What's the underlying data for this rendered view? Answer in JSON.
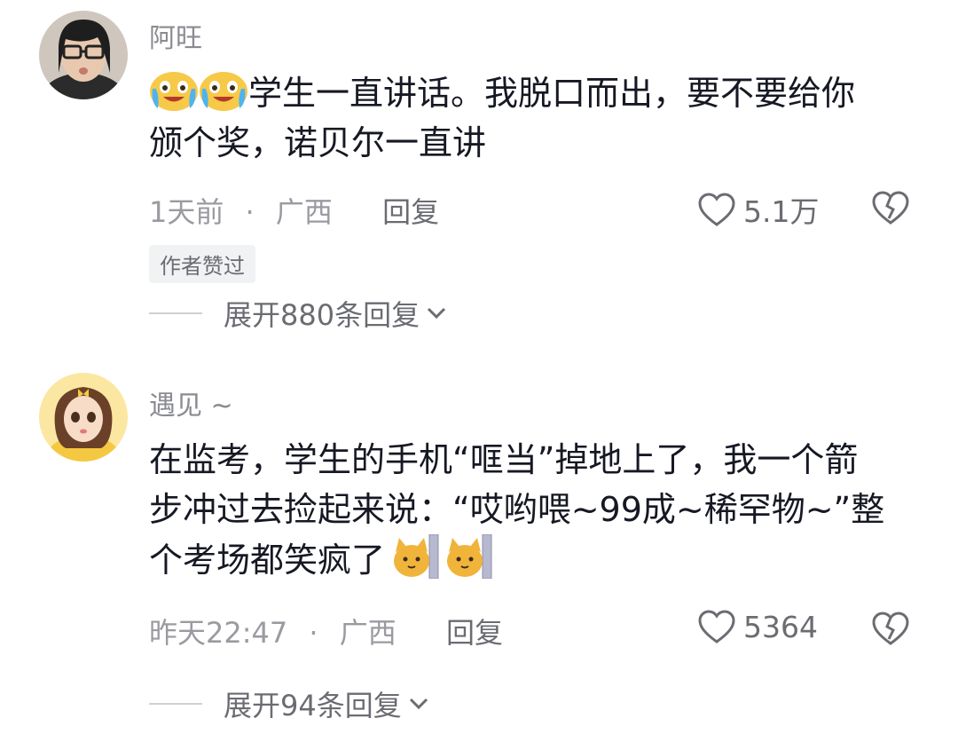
{
  "comments": [
    {
      "username": "阿旺",
      "content_lines": [
        "学生一直讲话。我脱口而出，要不要给你",
        "颁个奖，诺贝尔一直讲"
      ],
      "time": "1天前",
      "location": "广西",
      "reply_label": "回复",
      "likes": "5.1万",
      "author_liked_tag": "作者赞过",
      "expand_label": "展开880条回复",
      "emojis": [
        "crying-laughing-emoji",
        "crying-laughing-emoji"
      ]
    },
    {
      "username": "遇见 ~",
      "content_lines": [
        "在监考，学生的手机“哐当”掉地上了，我一个箭",
        "步冲过去捡起来说：“哎哟喂~99成~稀罕物~”整",
        "个考场都笑疯了"
      ],
      "time": "昨天22:47",
      "location": "广西",
      "reply_label": "回复",
      "likes": "5364",
      "expand_label": "展开94条回复",
      "emojis": [
        "cat-peeking-emoji",
        "cat-peeking-emoji"
      ]
    }
  ],
  "separator": "·",
  "colors": {
    "text": "#161823",
    "meta": "#9a9ba1",
    "username": "#8a8b91",
    "emoji_yellow": "#f7c948"
  }
}
